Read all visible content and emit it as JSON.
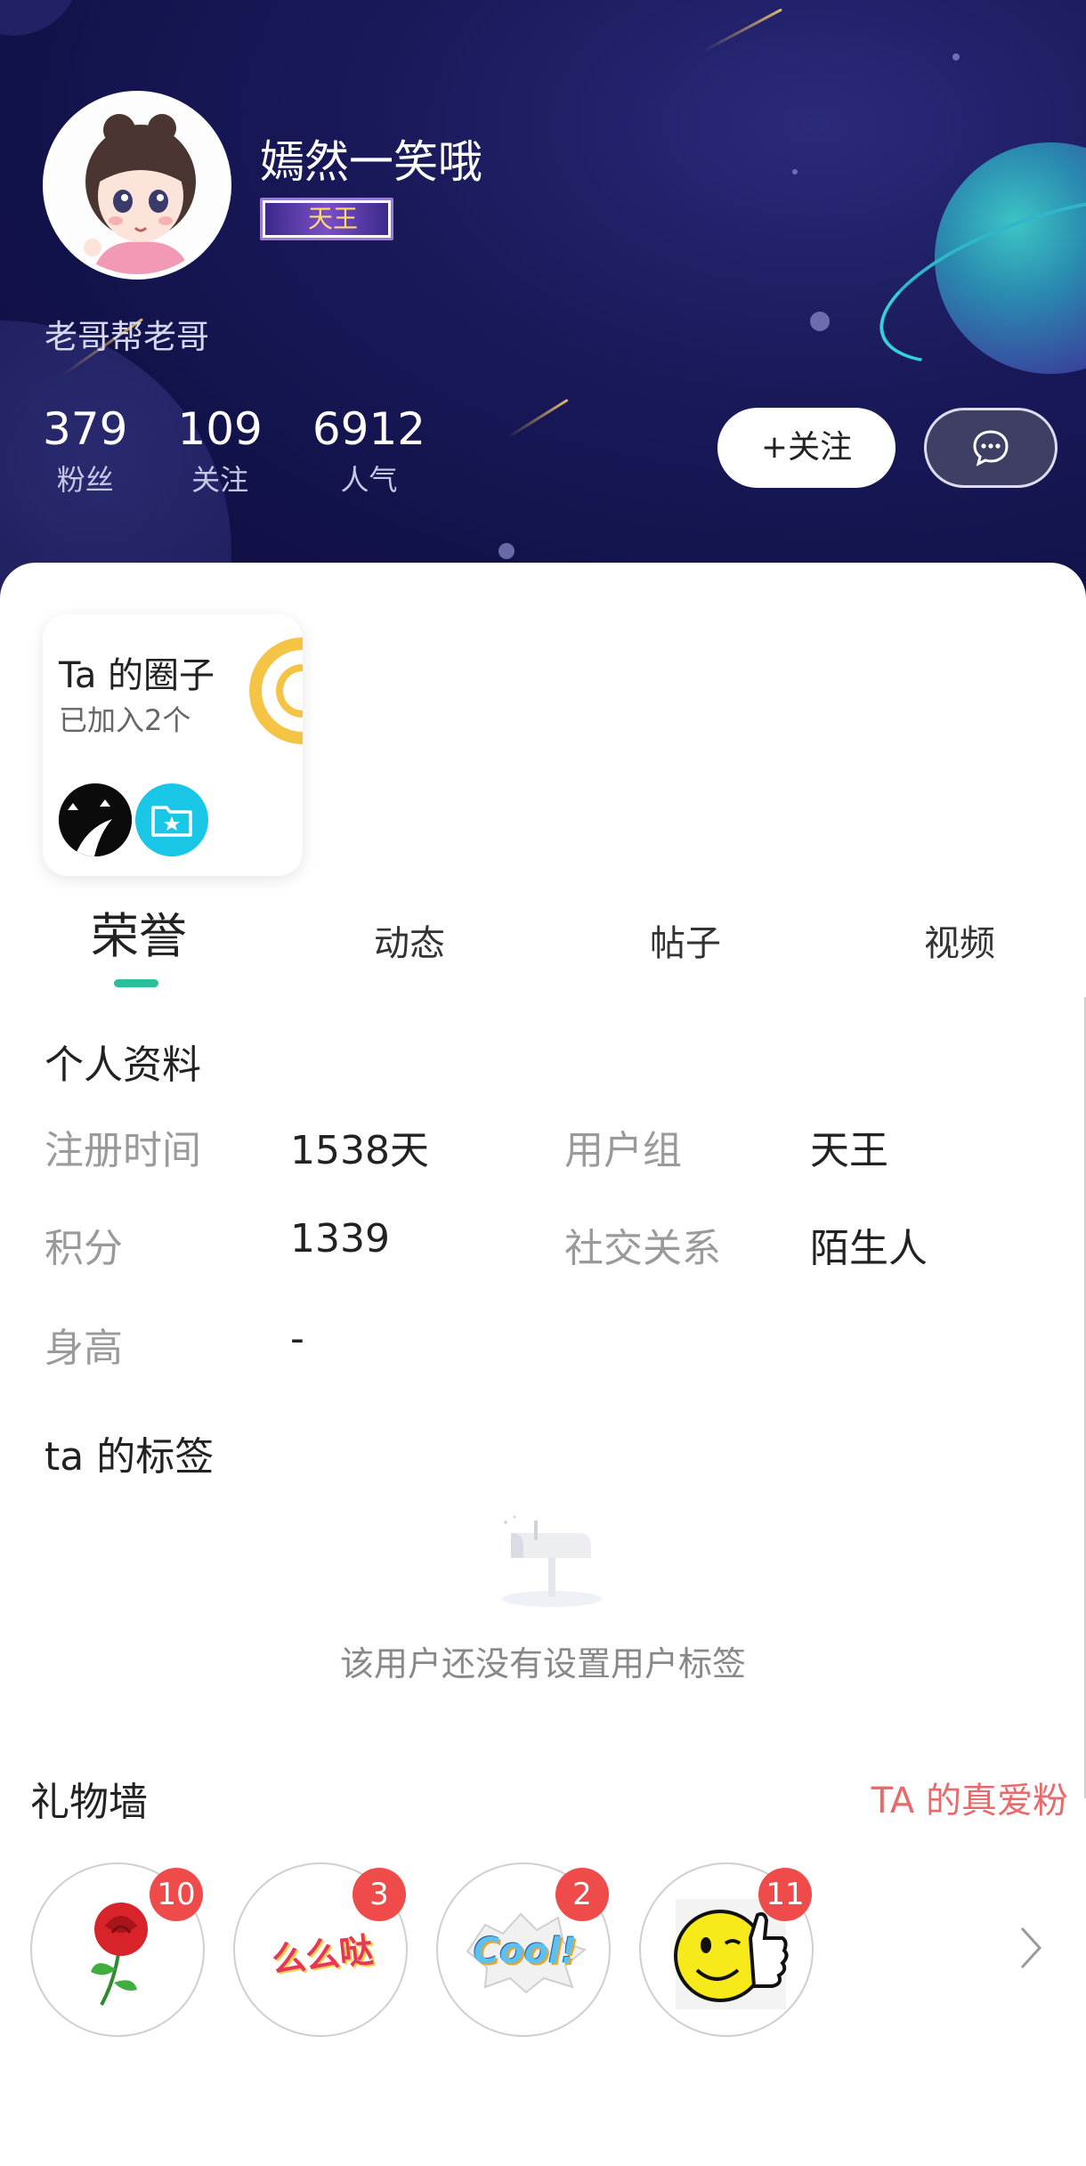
{
  "profile": {
    "username": "嫣然一笑哦",
    "vip_badge": "天王",
    "signature": "老哥帮老哥",
    "stats": [
      {
        "value": "379",
        "label": "粉丝"
      },
      {
        "value": "109",
        "label": "关注"
      },
      {
        "value": "6912",
        "label": "人气"
      }
    ],
    "follow_label": "+关注"
  },
  "circles": {
    "title": "Ta 的圈子",
    "subtitle": "已加入2个"
  },
  "tabs": [
    "荣誉",
    "动态",
    "帖子",
    "视频"
  ],
  "active_tab": "荣誉",
  "personal": {
    "title": "个人资料",
    "rows": [
      {
        "label": "注册时间",
        "value": "1538天"
      },
      {
        "label": "用户组",
        "value": "天王"
      },
      {
        "label": "积分",
        "value": "1339"
      },
      {
        "label": "社交关系",
        "value": "陌生人"
      },
      {
        "label": "身高",
        "value": "-"
      }
    ]
  },
  "tags": {
    "title": "ta 的标签",
    "empty_text": "该用户还没有设置用户标签"
  },
  "gifts": {
    "title": "礼物墙",
    "link": "TA 的真爱粉",
    "items": [
      {
        "icon": "rose-gift-icon",
        "count": "10"
      },
      {
        "icon": "memeda-gift-icon",
        "count": "3"
      },
      {
        "icon": "cool-gift-icon",
        "count": "2"
      },
      {
        "icon": "thumbs-up-gift-icon",
        "count": "11"
      }
    ],
    "memeda_text": "么么哒",
    "cool_text": "Cool!"
  },
  "colors": {
    "accent": "#2bbf9a",
    "link": "#e86a6a",
    "badge": "#ef4b4b"
  }
}
